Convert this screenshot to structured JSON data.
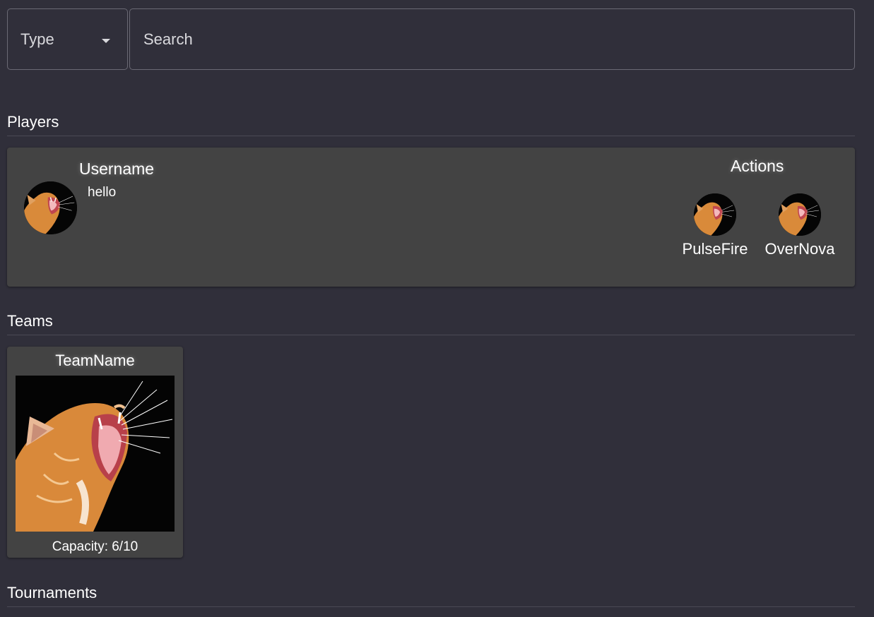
{
  "search": {
    "type_label": "Type",
    "placeholder": "Search"
  },
  "sections": {
    "players": "Players",
    "teams": "Teams",
    "tournaments": "Tournaments"
  },
  "player_card": {
    "username_header": "Username",
    "username": "hello",
    "actions_header": "Actions",
    "actions": [
      {
        "name": "PulseFire",
        "icon": "cat-avatar"
      },
      {
        "name": "OverNova",
        "icon": "cat-avatar"
      }
    ]
  },
  "team_card": {
    "name": "TeamName",
    "capacity": "Capacity: 6/10"
  },
  "colors": {
    "background": "#302f3a",
    "card": "#434343",
    "border": "#6b6a75"
  }
}
